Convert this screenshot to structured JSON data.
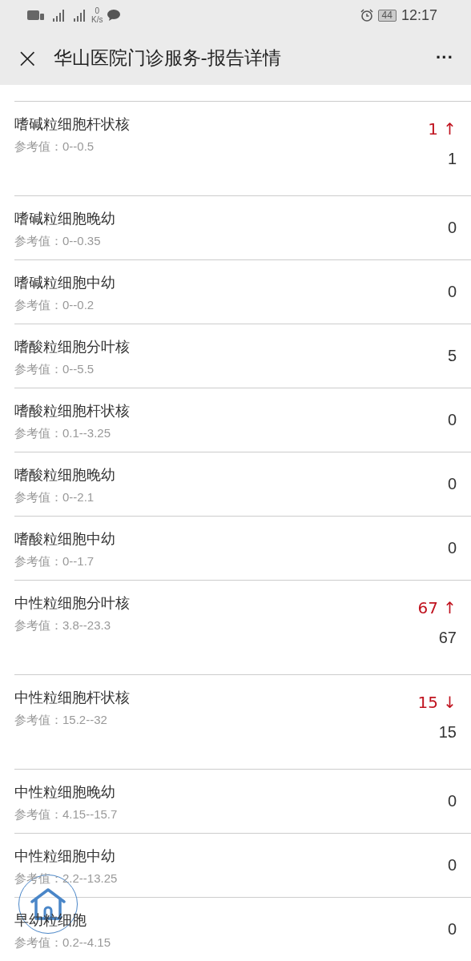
{
  "status_bar": {
    "net_speed_value": "0",
    "net_speed_unit": "K/s",
    "battery": "44",
    "time": "12:17"
  },
  "header": {
    "close": "×",
    "title": "华山医院门诊服务-报告详情",
    "more": "···"
  },
  "results": [
    {
      "name": "嗜碱粒细胞杆状核",
      "reference": "参考值：0--0.5",
      "value": "1",
      "flag": "1 ↑"
    },
    {
      "name": "嗜碱粒细胞晚幼",
      "reference": "参考值：0--0.35",
      "value": "0"
    },
    {
      "name": "嗜碱粒细胞中幼",
      "reference": "参考值：0--0.2",
      "value": "0"
    },
    {
      "name": "嗜酸粒细胞分叶核",
      "reference": "参考值：0--5.5",
      "value": "5"
    },
    {
      "name": "嗜酸粒细胞杆状核",
      "reference": "参考值：0.1--3.25",
      "value": "0"
    },
    {
      "name": "嗜酸粒细胞晚幼",
      "reference": "参考值：0--2.1",
      "value": "0"
    },
    {
      "name": "嗜酸粒细胞中幼",
      "reference": "参考值：0--1.7",
      "value": "0"
    },
    {
      "name": "中性粒细胞分叶核",
      "reference": "参考值：3.8--23.3",
      "value": "67",
      "flag": "67 ↑"
    },
    {
      "name": "中性粒细胞杆状核",
      "reference": "参考值：15.2--32",
      "value": "15",
      "flag": "15 ↓"
    },
    {
      "name": "中性粒细胞晚幼",
      "reference": "参考值：4.15--15.7",
      "value": "0"
    },
    {
      "name": "中性粒细胞中幼",
      "reference": "参考值：2.2--13.25",
      "value": "0"
    },
    {
      "name": "早幼粒细胞",
      "reference": "参考值：0.2--4.15",
      "value": "0"
    }
  ]
}
